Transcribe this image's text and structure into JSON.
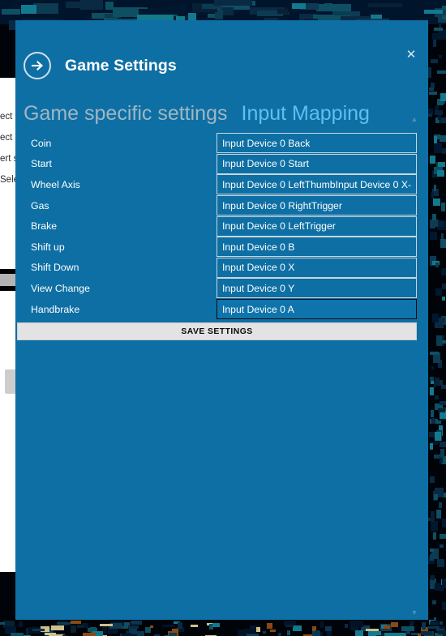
{
  "dialog": {
    "title": "Game Settings",
    "back_icon": "back-arrow-icon",
    "close_label": "✕",
    "accent_color": "#0e6fa4",
    "active_pivot_color": "#5dc0ef",
    "inactive_pivot_color": "#9fb7c4"
  },
  "pivots": [
    {
      "label": "Game specific settings",
      "state": "inactive"
    },
    {
      "label": "Input Mapping",
      "state": "active"
    }
  ],
  "mappings": [
    {
      "label": "Coin",
      "value": "Input Device 0 Back",
      "focused": false
    },
    {
      "label": "Start",
      "value": "Input Device 0 Start",
      "focused": false
    },
    {
      "label": "Wheel Axis",
      "value": "Input Device 0 LeftThumbInput Device 0 X-",
      "focused": false
    },
    {
      "label": "Gas",
      "value": "Input Device 0 RightTrigger",
      "focused": false
    },
    {
      "label": "Brake",
      "value": "Input Device 0 LeftTrigger",
      "focused": false
    },
    {
      "label": "Shift up",
      "value": "Input Device 0 B",
      "focused": false
    },
    {
      "label": "Shift Down",
      "value": "Input Device 0 X",
      "focused": false
    },
    {
      "label": "View Change",
      "value": "Input Device 0 Y",
      "focused": false
    },
    {
      "label": "Handbrake",
      "value": "Input Device 0 A",
      "focused": true
    }
  ],
  "save_button": {
    "label": "SAVE SETTINGS"
  },
  "scrollbar": {
    "up_arrow": "▲",
    "down_arrow": "▼"
  },
  "background_window": {
    "text_fragments": [
      "ect ",
      "ect ",
      "ert s",
      "Sele"
    ]
  }
}
